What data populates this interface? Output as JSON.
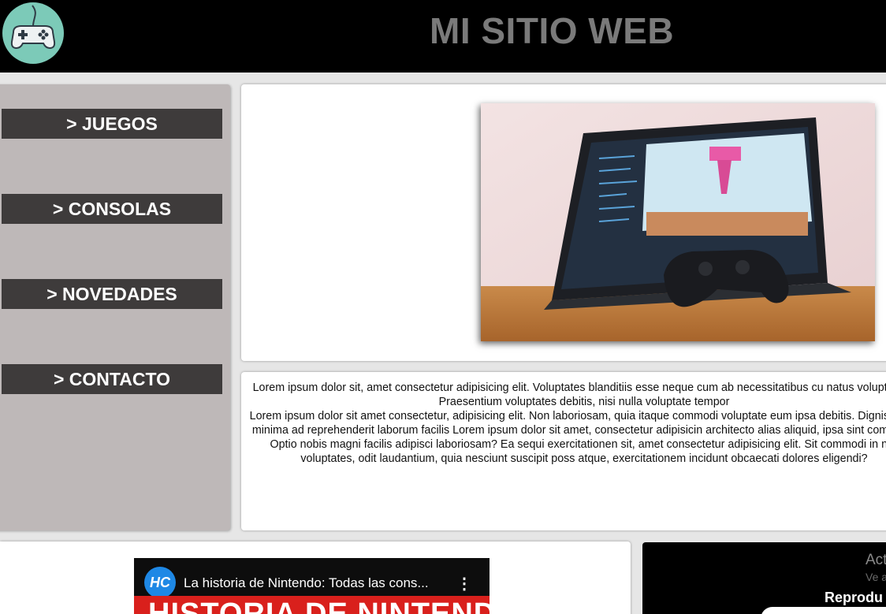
{
  "header": {
    "title": "MI SITIO WEB",
    "logo_icon": "gamepad-icon"
  },
  "sidebar": {
    "items": [
      {
        "label": "> JUEGOS"
      },
      {
        "label": "> CONSOLAS"
      },
      {
        "label": "> NOVEDADES"
      },
      {
        "label": "> CONTACTO"
      }
    ]
  },
  "hero": {
    "image": "laptop-with-game-controller-photo"
  },
  "content": {
    "paragraphs": [
      "Lorem ipsum dolor sit, amet consectetur adipisicing elit. Voluptates blanditiis esse neque cum ab necessitatibus cu natus voluptatem! Praesentium voluptates debitis, nisi nulla voluptate tempor",
      "Lorem ipsum dolor sit amet consectetur, adipisicing elit. Non laboriosam, quia itaque commodi voluptate eum ipsa debitis. Dignissimos minima ad reprehenderit laborum facilis Lorem ipsum dolor sit amet, consectetur adipisicin architecto alias aliquid, ipsa sint commodi! Optio nobis magni facilis adipisci laboriosam? Ea sequi exercitationen sit, amet consectetur adipisicing elit. Sit commodi in nisi voluptates, odit laudantium, quia nesciunt suscipit poss atque, exercitationem incidunt obcaecati dolores eligendi?"
    ]
  },
  "video": {
    "channel_logo_text": "HC",
    "title": "La historia de Nintendo: Todas las cons...",
    "menu_icon": "more-vertical-icon",
    "thumbnail_text": "HISTORIA DE NINTENDO"
  },
  "side_panel": {
    "line1": "Act",
    "line2": "Ve a",
    "line3": "Reprodu"
  },
  "colors": {
    "header_bg": "#000000",
    "title": "#7a7a7a",
    "sidebar_bg": "#beb8b8",
    "nav_button_bg": "#3e3b3b",
    "logo_bg": "#7ccab8"
  }
}
